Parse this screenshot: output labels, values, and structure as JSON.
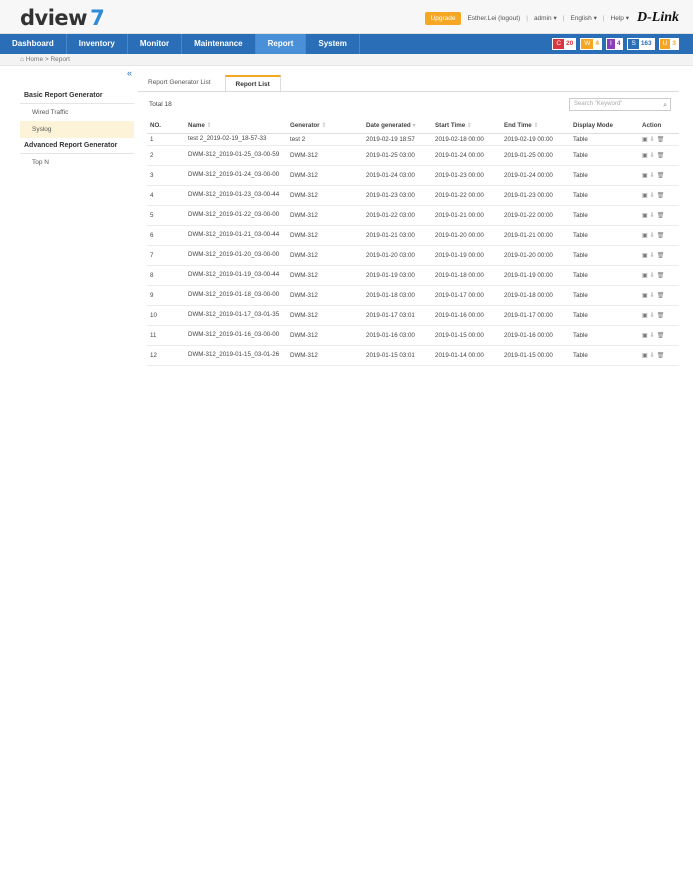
{
  "app": {
    "logo_text": "dview",
    "logo_version": "7",
    "upgrade_label": "Upgrade",
    "user_label": "Esther.Lei (logout)",
    "role_label": "admin",
    "language_label": "English",
    "help_label": "Help",
    "brand": "D-Link"
  },
  "nav": {
    "items": [
      "Dashboard",
      "Inventory",
      "Monitor",
      "Maintenance",
      "Report",
      "System"
    ]
  },
  "badges": [
    {
      "key": "C",
      "value": "20"
    },
    {
      "key": "W",
      "value": "4"
    },
    {
      "key": "I",
      "value": "4"
    },
    {
      "key": "S",
      "value": "163"
    },
    {
      "key": "U",
      "value": "3"
    }
  ],
  "breadcrumb": "Home > Report",
  "sidebar": {
    "collapse": "«",
    "basic_heading": "Basic Report Generator",
    "basic_items": [
      "Wired Traffic",
      "Syslog"
    ],
    "advanced_heading": "Advanced Report Generator",
    "advanced_items": [
      "Top N"
    ]
  },
  "tabs": [
    "Report Generator List",
    "Report List"
  ],
  "total_label": "Total 18",
  "search_placeholder": "Search \"Keyword\"",
  "table": {
    "headers": {
      "no": "NO.",
      "name": "Name",
      "generator": "Generator",
      "date": "Date generated",
      "start": "Start Time",
      "end": "End Time",
      "mode": "Display Mode",
      "action": "Action"
    },
    "rows": [
      {
        "no": "1",
        "name": "test 2_2019-02-19_18-57-33",
        "generator": "test 2",
        "date": "2019-02-19 18:57",
        "start": "2019-02-18 00:00",
        "end": "2019-02-19 00:00",
        "mode": "Table"
      },
      {
        "no": "2",
        "name": "DWM-312_2019-01-25_03-00-59",
        "generator": "DWM-312",
        "date": "2019-01-25 03:00",
        "start": "2019-01-24 00:00",
        "end": "2019-01-25 00:00",
        "mode": "Table"
      },
      {
        "no": "3",
        "name": "DWM-312_2019-01-24_03-00-00",
        "generator": "DWM-312",
        "date": "2019-01-24 03:00",
        "start": "2019-01-23 00:00",
        "end": "2019-01-24 00:00",
        "mode": "Table"
      },
      {
        "no": "4",
        "name": "DWM-312_2019-01-23_03-00-44",
        "generator": "DWM-312",
        "date": "2019-01-23 03:00",
        "start": "2019-01-22 00:00",
        "end": "2019-01-23 00:00",
        "mode": "Table"
      },
      {
        "no": "5",
        "name": "DWM-312_2019-01-22_03-00-00",
        "generator": "DWM-312",
        "date": "2019-01-22 03:00",
        "start": "2019-01-21 00:00",
        "end": "2019-01-22 00:00",
        "mode": "Table"
      },
      {
        "no": "6",
        "name": "DWM-312_2019-01-21_03-00-44",
        "generator": "DWM-312",
        "date": "2019-01-21 03:00",
        "start": "2019-01-20 00:00",
        "end": "2019-01-21 00:00",
        "mode": "Table"
      },
      {
        "no": "7",
        "name": "DWM-312_2019-01-20_03-00-00",
        "generator": "DWM-312",
        "date": "2019-01-20 03:00",
        "start": "2019-01-19 00:00",
        "end": "2019-01-20 00:00",
        "mode": "Table"
      },
      {
        "no": "8",
        "name": "DWM-312_2019-01-19_03-00-44",
        "generator": "DWM-312",
        "date": "2019-01-19 03:00",
        "start": "2019-01-18 00:00",
        "end": "2019-01-19 00:00",
        "mode": "Table"
      },
      {
        "no": "9",
        "name": "DWM-312_2019-01-18_03-00-00",
        "generator": "DWM-312",
        "date": "2019-01-18 03:00",
        "start": "2019-01-17 00:00",
        "end": "2019-01-18 00:00",
        "mode": "Table"
      },
      {
        "no": "10",
        "name": "DWM-312_2019-01-17_03-01-35",
        "generator": "DWM-312",
        "date": "2019-01-17 03:01",
        "start": "2019-01-16 00:00",
        "end": "2019-01-17 00:00",
        "mode": "Table"
      },
      {
        "no": "11",
        "name": "DWM-312_2019-01-16_03-00-00",
        "generator": "DWM-312",
        "date": "2019-01-16 03:00",
        "start": "2019-01-15 00:00",
        "end": "2019-01-16 00:00",
        "mode": "Table"
      },
      {
        "no": "12",
        "name": "DWM-312_2019-01-15_03-01-26",
        "generator": "DWM-312",
        "date": "2019-01-15 03:01",
        "start": "2019-01-14 00:00",
        "end": "2019-01-15 00:00",
        "mode": "Table"
      }
    ]
  },
  "colors": {
    "nav_bg": "#2a6eb8",
    "accent": "#f5a623",
    "active_sidebar": "#fdf3d8"
  }
}
